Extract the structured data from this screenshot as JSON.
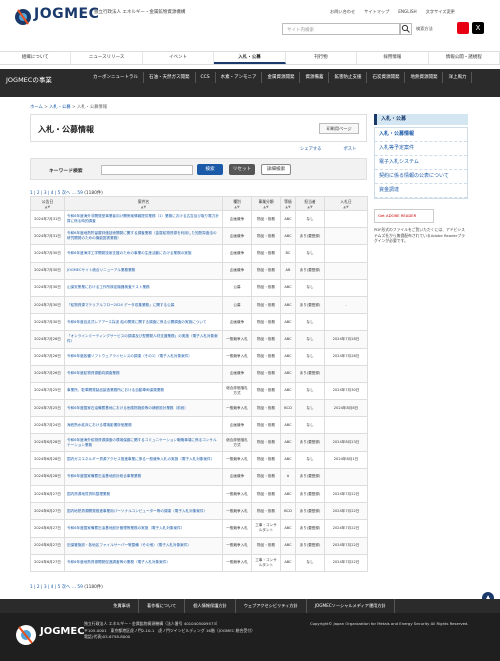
{
  "header": {
    "logo_text": "JOGMEC",
    "org_name": "独立行政法人 エネルギー・金属鉱物資源機構",
    "topnav": [
      "お問い合わせ",
      "サイトマップ",
      "ENGLISH",
      "文字サイズ変更"
    ],
    "search_placeholder": "サイト内検索",
    "detail_search": "検索方法",
    "x_label": "X"
  },
  "gnav": [
    "組織について",
    "ニュースリリース",
    "イベント",
    "入札・公募",
    "刊行物",
    "採用情報",
    "情報公開・諸規程"
  ],
  "gnav_active": 3,
  "business": {
    "title": "JOGMECの事業",
    "items": [
      "カーボンニュートラル",
      "石油・天然ガス開発",
      "CCS",
      "水素・アンモニア",
      "金属資源開発",
      "資源備蓄",
      "鉱害防止支援",
      "石炭資源開発",
      "地熱資源開発",
      "洋上風力"
    ]
  },
  "breadcrumb": [
    "ホーム",
    "入札・公募",
    "入札・公募情報"
  ],
  "main": {
    "title": "入札・公募情報",
    "print_label": "印刷用ページ",
    "share": [
      "シェアする",
      "ポスト"
    ],
    "kw_label": "キーワード検索",
    "kw_search": "検索",
    "kw_reset": "リセット",
    "kw_detail": "詳細検索",
    "pager_text": "1 | 2 | 3 | 4 | 5 次へ … 59",
    "pager_count": "(1180件)"
  },
  "table": {
    "headers": [
      "公告日",
      "案件名",
      "種別",
      "事業分類",
      "等級",
      "担当者",
      "入札日"
    ],
    "rows": [
      [
        "2024年7月31日",
        "令和6年度海外非開発型事業者向け関係案情報提供業務（1）業務における広告及び取り電力計算に係る時的調査",
        "企画競争",
        "物品・役務",
        "ABC",
        "なし",
        ""
      ],
      [
        "2024年7月31日",
        "令和6年度地熱貯留層評価技術開発に関する調査業務（金属鉱物資源を利用した知熱探査法の研究開発のための機能図書業務）",
        "企画競争",
        "物品・役務",
        "ABC",
        "あり(要登録)",
        ""
      ],
      [
        "2024年7月30日",
        "令和6年度海洋工学開発技術支援のための事業の生産活動における業務の実施",
        "企画競争",
        "物品・役務",
        "BC",
        "なし",
        ""
      ],
      [
        "2024年7月30日",
        "JOGMECサイト統合リニューアル業務業務",
        "企画競争",
        "物品・役務",
        "AB",
        "あり(要登録)",
        ""
      ],
      [
        "2024年7月30日",
        "山保安策業における工作所検定機器検査テスト業務",
        "公募",
        "物品・役務",
        "ABC",
        "なし",
        ""
      ],
      [
        "2024年7月30日",
        "「鉱物資源マテリアルフロー2024 データ収集業務」に関する公募",
        "公募",
        "物品・役務",
        "ABC",
        "あり(要登録)",
        "-"
      ],
      [
        "2024年7月30日",
        "令和6年度自走式レアアース採泥 船の開発に関する調査に係る公開調査の実施について",
        "企画競争",
        "物品・役務",
        "ABC",
        "なし",
        ""
      ],
      [
        "2024年7月26日",
        "「オンラインミーティングサービスの調達及び型開発人材支援業務」の実施（電子入札対象案件）",
        "一般競争入札",
        "物品・役務",
        "ABC",
        "なし",
        "2024年7月28日"
      ],
      [
        "2024年7月26日",
        "令和6年度各種ソフトウェアライセンスの調達（その1）（電子入札対象案件）",
        "一般競争入札",
        "物品・役務",
        "ABC",
        "なし",
        "2024年7月28日"
      ],
      [
        "2024年7月26日",
        "令和6年度鉱物資源動向調査業務",
        "企画競争",
        "物品・役務",
        "ABC",
        "あり(要登録)",
        ""
      ],
      [
        "2024年7月25日",
        "事業所、駐車開発製品製造業務所における自動車両保険業務",
        "総合評価落札方式",
        "物品・役務",
        "ABC",
        "なし",
        "2024年7月30日"
      ],
      [
        "2024年7月25日",
        "令和6年度国家石油備蓄基地における危険物施設等の補修設計業務（前段）",
        "一般競争入札",
        "物品・役務",
        "BCD",
        "なし",
        "2024年8月8日"
      ],
      [
        "2024年7月24日",
        "海底熱水鉱床における環境影響評価業務",
        "企画競争",
        "物品・役務",
        "ABC",
        "なし",
        ""
      ],
      [
        "2024年6月28日",
        "令和6年度海外鉱物資源調査の環境保護に関するコミュニケーション戦略事項に係るコンサルテーション業務",
        "総合評価落札方式",
        "物品・役務",
        "ABC",
        "あり(要登録)",
        "2024年8月23日"
      ],
      [
        "2024年6月28日",
        "国内ガスエネルギー資源アクセス推進事業に係る一般競争入札の実施（電子入札対象案件）",
        "一般競争入札",
        "物品・役務",
        "ABC",
        "なし",
        "2024年8月1日"
      ],
      [
        "2024年6月28日",
        "令和6年度国家備蓄石油基地設計総合事業業務",
        "企画競争",
        "物品・役務",
        "A",
        "あり(要登録)",
        ""
      ],
      [
        "2024年6月27日",
        "国内資源地質資料整理業務",
        "一般競争入札",
        "物品・役務",
        "ABC",
        "あり(要登録)",
        "2024年7月22日"
      ],
      [
        "2024年6月27日",
        "国内地熱資源開発推進事業用パーソナルコンピューター等の調達（電子入札対象案件）",
        "一般競争入札",
        "物品・役務",
        "BCD",
        "あり(要登録)",
        "2024年7月22日"
      ],
      [
        "2024年6月27日",
        "令和6年度国家備蓄石油基地設計管理等業務の実施（電子入札対象案件）",
        "一般競争入札",
        "工事・コンサルタント",
        "ABC",
        "あり(要登録)",
        "2024年7月22日"
      ],
      [
        "2024年6月27日",
        "旧保管施設・各地区ファイルサーバー等整備（その他）（電子入札対象案件）",
        "一般競争入札",
        "物品・役務",
        "ABC",
        "あり(要登録)",
        "2024年7月22日"
      ],
      [
        "2024年6月27日",
        "令和6年度地熱資源開発促進調査等の業務（電子入札対象案件）",
        "一般競争入札",
        "工事・コンサルタント",
        "ABC",
        "なし",
        "2024年7月22日"
      ]
    ]
  },
  "side": {
    "head": "入札・公募",
    "items": [
      "入札・公募情報",
      "入札等予定案件",
      "電子入札システム",
      "契約に係る情報の公表について",
      "資金調達"
    ],
    "current": 0,
    "adobe": "Get ADOBE READER",
    "note": "PDF形式のファイルをご覧いただくには、アドビシステムズ社から無償配布されているAdobe Readerプラグインが必要です。"
  },
  "footer": {
    "links": [
      "免責事項",
      "著作権について",
      "個人情報保護方針",
      "ウェブアクセシビリティ方針",
      "JOGMECソーシャルメディア運用方針"
    ],
    "logo_text": "JOGMEC",
    "addr": [
      "独立行政法人 エネルギー・金属鉱物資源機構（法人番号 4010405009573）",
      "〒105-0001　東京都港区虎ノ門2-10-1　虎ノ門ツインビルディング 16階（JOGMEC 総合受付）",
      "電話(代表)03-6758-8000"
    ],
    "copy": "Copyright© Japan Organization for Metals and Energy Security All Rights Reserved."
  }
}
